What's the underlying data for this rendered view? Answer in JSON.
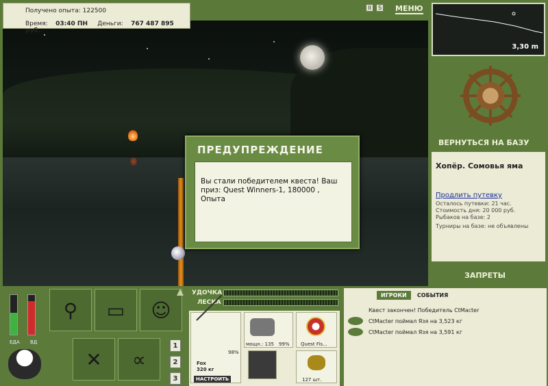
{
  "info": {
    "exp_label": "Получено опыта:",
    "exp_value": "122500",
    "time_label": "Время:",
    "time_value": "03:40 ПН",
    "money_label": "Деньги:",
    "money_value": "767 487 895 руб."
  },
  "top": {
    "pause_icon": "pause-icon",
    "sound_icon": "sound-icon",
    "menu_label": "МЕНЮ"
  },
  "depth": {
    "value": "3,30 m"
  },
  "right": {
    "return_label": "ВЕРНУТЬСЯ НА БАЗУ",
    "base_title": "Хопёр. Сомовья яма",
    "extend_link": "Продлить путевку",
    "left_label": "Осталось путевки: 21 час.",
    "cost_label": "Стоимость дня: 20 000 руб.",
    "anglers_label": "Рыбаков на базе: 2",
    "tournaments_label": "Турниры на базе: не объявлены",
    "bans_label": "ЗАПРЕТЫ"
  },
  "dialog": {
    "title": "ПРЕДУПРЕЖДЕНИЕ",
    "message": "Вы стали победителем квеста! Ваш приз: Quest Winners-1, 180000 , Опыта"
  },
  "status": {
    "food_label": "ЕДА",
    "health_label": "ВД",
    "food_level": 0.55,
    "health_level": 0.85
  },
  "pages": [
    "1",
    "2",
    "3"
  ],
  "equipment": {
    "rod_label": "УДОЧКА",
    "line_label": "ЛЕСКА",
    "rod_name": "Fox",
    "rod_weight": "320 кг",
    "rod_condition": "98%",
    "reel_power": "мощн.: 135",
    "reel_condition": "99%",
    "line_name": "Quest Fis...",
    "bait_weight": "127 шт.",
    "setup_button": "НАСТРОИТЬ"
  },
  "events": {
    "tab_players": "ИГРОКИ",
    "tab_events": "СОБЫТИЯ",
    "items": [
      "Квест закончен! Победитель CtMacter",
      "CtMacter поймал Язя на 3,523 кг",
      "CtMacter поймал Язя на 3,591 кг"
    ]
  },
  "colors": {
    "panel_green": "#5c7b3b",
    "panel_cream": "#ecebd6",
    "dialog_green": "#6a8b44"
  }
}
